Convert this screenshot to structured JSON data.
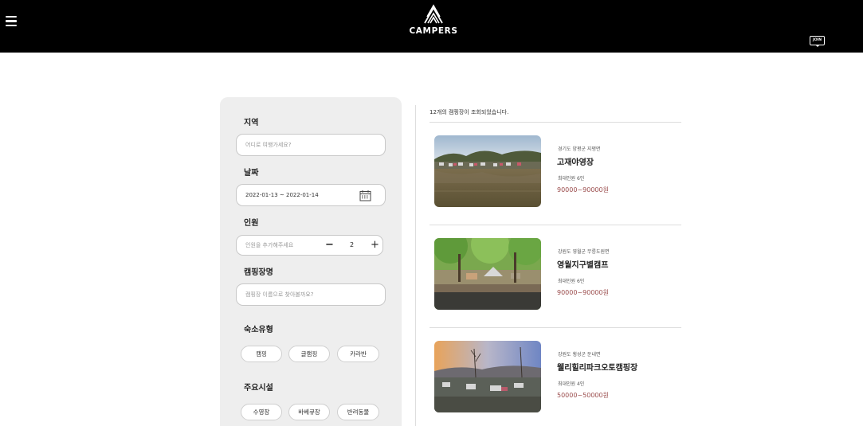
{
  "header": {
    "logo_text": "CAMPERS",
    "join_label": "JOIN"
  },
  "filter": {
    "region_label": "지역",
    "region_placeholder": "어디로 여행가세요?",
    "date_label": "날짜",
    "date_value": "2022-01-13 ~ 2022-01-14",
    "people_label": "인원",
    "people_placeholder": "인원을 추가해주세요",
    "people_count": "2",
    "minus_label": "−",
    "plus_label": "+",
    "camp_name_label": "캠핑장명",
    "camp_name_placeholder": "캠핑장 이름으로 찾아볼까요?",
    "lodging_label": "숙소유형",
    "lodging_types": [
      "캠핑",
      "글램핑",
      "카라반"
    ],
    "facilities_label": "주요시설",
    "facilities": [
      "수영장",
      "바베큐장",
      "반려동물"
    ]
  },
  "results": {
    "count_text": "12개의 캠핑장이 조회되었습니다.",
    "items": [
      {
        "location": "경기도 양평군 지평면",
        "name": "고재야영장",
        "capacity": "최대인원 6인",
        "price": "90000~90000원"
      },
      {
        "location": "강원도 영월군 무릉도원면",
        "name": "영월지구별캠프",
        "capacity": "최대인원 6인",
        "price": "90000~90000원"
      },
      {
        "location": "강원도 횡성군 둔내면",
        "name": "웰리힐리파크오토캠핑장",
        "capacity": "최대인원 4인",
        "price": "50000~50000원"
      }
    ]
  }
}
